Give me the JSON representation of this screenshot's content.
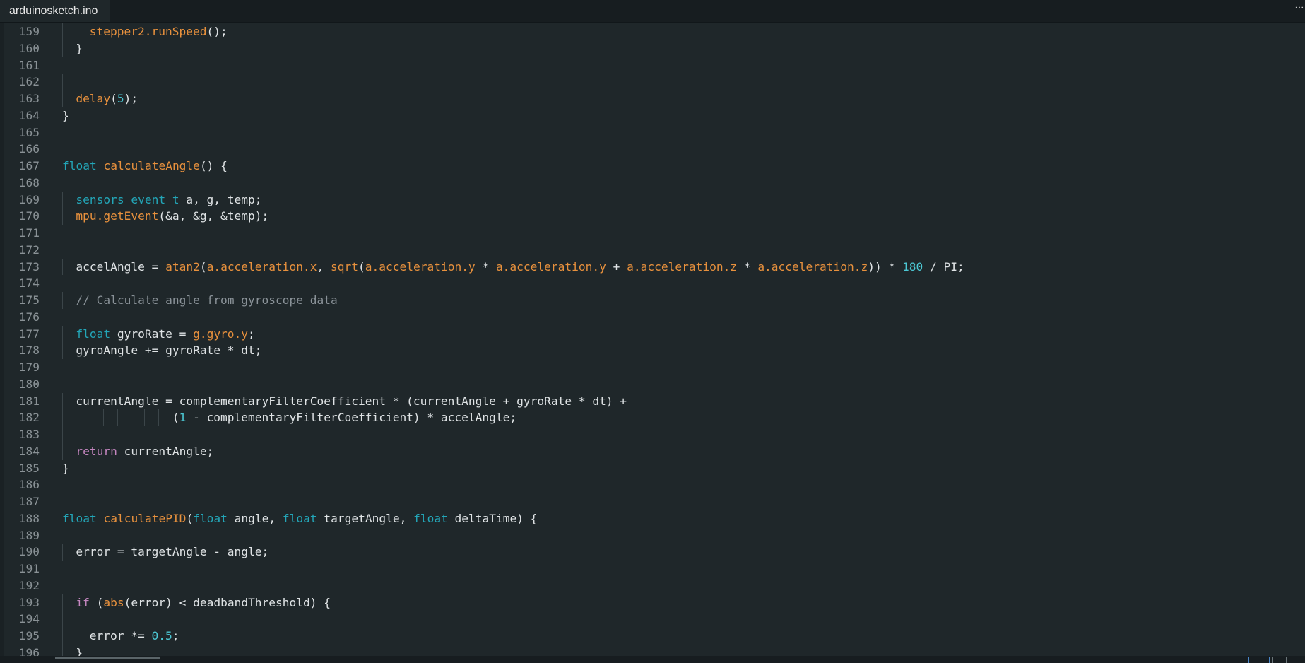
{
  "tab": {
    "filename": "arduinosketch.ino",
    "overflow_label": "···"
  },
  "colors": {
    "background": "#1f272a",
    "type": "#23a6b8",
    "keyword": "#c586c0",
    "function": "#e8913d",
    "number": "#4cc8d4",
    "comment": "#8a9298",
    "text": "#dfe3e5"
  },
  "lines": [
    {
      "n": "159",
      "g": 2,
      "t": [
        [
          "stepper2.runSpeed",
          "fn"
        ],
        [
          "();",
          ""
        ]
      ]
    },
    {
      "n": "160",
      "g": 1,
      "t": [
        [
          "}",
          ""
        ]
      ]
    },
    {
      "n": "161",
      "g": 0,
      "t": []
    },
    {
      "n": "162",
      "g": 1,
      "t": []
    },
    {
      "n": "163",
      "g": 1,
      "t": [
        [
          "delay",
          "fn"
        ],
        [
          "(",
          ""
        ],
        [
          "5",
          "num"
        ],
        [
          ");",
          ""
        ]
      ]
    },
    {
      "n": "164",
      "g": 0,
      "t": [
        [
          "}",
          ""
        ]
      ]
    },
    {
      "n": "165",
      "g": 0,
      "t": []
    },
    {
      "n": "166",
      "g": 0,
      "t": []
    },
    {
      "n": "167",
      "g": 0,
      "t": [
        [
          "float",
          "kw-type"
        ],
        [
          " ",
          ""
        ],
        [
          "calculateAngle",
          "fn"
        ],
        [
          "() {",
          ""
        ]
      ]
    },
    {
      "n": "168",
      "g": 0,
      "t": []
    },
    {
      "n": "169",
      "g": 1,
      "t": [
        [
          "sensors_event_t",
          "kw-type"
        ],
        [
          " a, g, temp;",
          ""
        ]
      ]
    },
    {
      "n": "170",
      "g": 1,
      "t": [
        [
          "mpu.getEvent",
          "fn"
        ],
        [
          "(&a, &g, &temp);",
          ""
        ]
      ]
    },
    {
      "n": "171",
      "g": 0,
      "t": []
    },
    {
      "n": "172",
      "g": 0,
      "t": []
    },
    {
      "n": "173",
      "g": 1,
      "t": [
        [
          "accelAngle = ",
          ""
        ],
        [
          "atan2",
          "fn"
        ],
        [
          "(",
          ""
        ],
        [
          "a.acceleration.x",
          "fn"
        ],
        [
          ", ",
          ""
        ],
        [
          "sqrt",
          "fn"
        ],
        [
          "(",
          ""
        ],
        [
          "a.acceleration.y",
          "fn"
        ],
        [
          " * ",
          ""
        ],
        [
          "a.acceleration.y",
          "fn"
        ],
        [
          " + ",
          ""
        ],
        [
          "a.acceleration.z",
          "fn"
        ],
        [
          " * ",
          ""
        ],
        [
          "a.acceleration.z",
          "fn"
        ],
        [
          ")) * ",
          ""
        ],
        [
          "180",
          "num"
        ],
        [
          " / PI;",
          ""
        ]
      ]
    },
    {
      "n": "174",
      "g": 0,
      "t": []
    },
    {
      "n": "175",
      "g": 1,
      "t": [
        [
          "// Calculate angle from gyroscope data",
          "cm"
        ]
      ]
    },
    {
      "n": "176",
      "g": 0,
      "t": []
    },
    {
      "n": "177",
      "g": 1,
      "t": [
        [
          "float",
          "kw-type"
        ],
        [
          " gyroRate = ",
          ""
        ],
        [
          "g.gyro.y",
          "fn"
        ],
        [
          ";",
          ""
        ]
      ]
    },
    {
      "n": "178",
      "g": 1,
      "t": [
        [
          "gyroAngle += gyroRate * dt;",
          ""
        ]
      ]
    },
    {
      "n": "179",
      "g": 0,
      "t": []
    },
    {
      "n": "180",
      "g": 0,
      "t": []
    },
    {
      "n": "181",
      "g": 1,
      "t": [
        [
          "currentAngle = complementaryFilterCoefficient * (currentAngle + gyroRate * dt) +",
          ""
        ]
      ]
    },
    {
      "n": "182",
      "g": 8,
      "t": [
        [
          "              (",
          ""
        ],
        [
          "1",
          "num"
        ],
        [
          " - complementaryFilterCoefficient) * accelAngle;",
          ""
        ]
      ]
    },
    {
      "n": "183",
      "g": 1,
      "t": []
    },
    {
      "n": "184",
      "g": 1,
      "t": [
        [
          "return",
          "kw"
        ],
        [
          " currentAngle;",
          ""
        ]
      ]
    },
    {
      "n": "185",
      "g": 0,
      "t": [
        [
          "}",
          ""
        ]
      ]
    },
    {
      "n": "186",
      "g": 0,
      "t": []
    },
    {
      "n": "187",
      "g": 0,
      "t": []
    },
    {
      "n": "188",
      "g": 0,
      "t": [
        [
          "float",
          "kw-type"
        ],
        [
          " ",
          ""
        ],
        [
          "calculatePID",
          "fn"
        ],
        [
          "(",
          ""
        ],
        [
          "float",
          "kw-type"
        ],
        [
          " angle, ",
          ""
        ],
        [
          "float",
          "kw-type"
        ],
        [
          " targetAngle, ",
          ""
        ],
        [
          "float",
          "kw-type"
        ],
        [
          " deltaTime) {",
          ""
        ]
      ]
    },
    {
      "n": "189",
      "g": 0,
      "t": []
    },
    {
      "n": "190",
      "g": 1,
      "t": [
        [
          "error = targetAngle - angle;",
          ""
        ]
      ]
    },
    {
      "n": "191",
      "g": 0,
      "t": []
    },
    {
      "n": "192",
      "g": 0,
      "t": []
    },
    {
      "n": "193",
      "g": 1,
      "t": [
        [
          "if",
          "kw"
        ],
        [
          " (",
          ""
        ],
        [
          "abs",
          "fn"
        ],
        [
          "(error) < deadbandThreshold) {",
          ""
        ]
      ]
    },
    {
      "n": "194",
      "g": 2,
      "t": []
    },
    {
      "n": "195",
      "g": 2,
      "t": [
        [
          "error *= ",
          ""
        ],
        [
          "0.5",
          "num"
        ],
        [
          ";",
          ""
        ]
      ]
    },
    {
      "n": "196",
      "g": 1,
      "t": [
        [
          "}",
          ""
        ]
      ]
    }
  ]
}
